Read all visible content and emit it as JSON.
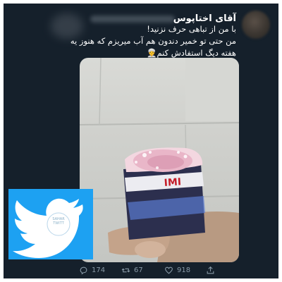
{
  "tweet": {
    "display_name": "آقای اختاپوس",
    "text_line1": "با من از تباهی حرف نزنید!",
    "text_line2": "من حتی تو خمیر دندون هم آب میریزم که هنوز یه",
    "text_line3": "هفته دیگ استفادش کنم👳"
  },
  "actions": {
    "reply_count": "174",
    "retweet_count": "67",
    "like_count": "918"
  },
  "logo": {
    "circle_line1": "SAHAR",
    "circle_line2": "TWITT"
  },
  "colors": {
    "background": "#15202b",
    "brand_blue": "#1da1f2",
    "muted": "#8899a6"
  },
  "icons": [
    "reply-icon",
    "retweet-icon",
    "like-icon",
    "share-icon",
    "twitter-bird-icon"
  ]
}
